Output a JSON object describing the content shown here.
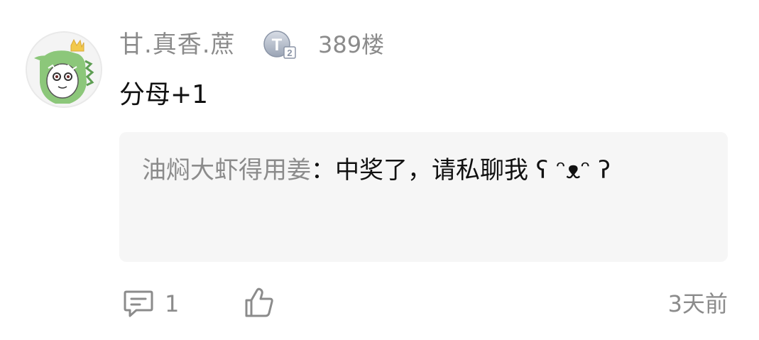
{
  "comment": {
    "username": "甘.真香.蔗",
    "level_badge_icon": "level-t2-badge",
    "floor": "389楼",
    "content": "分母+1",
    "reply": {
      "author": "油焖大虾得用姜",
      "separator": "：",
      "text": "中奖了，请私聊我 ʕ ᵔᴥᵔ ʔ"
    },
    "reply_count": "1",
    "time": "3天前"
  },
  "colors": {
    "muted_text": "#8b8b8b",
    "main_text": "#111111",
    "reply_bg": "#f6f6f6",
    "avatar_green": "#8cc77a"
  },
  "icons": {
    "comment": "comment-bubble-icon",
    "like": "thumbs-up-icon"
  }
}
